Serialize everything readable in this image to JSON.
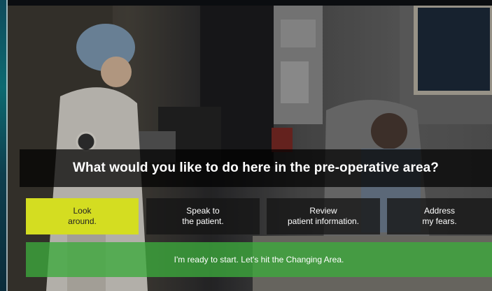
{
  "question": "What would you like to do here in the pre-operative area?",
  "options": [
    {
      "label": "Look\naround.",
      "selected": true
    },
    {
      "label": "Speak to\nthe patient.",
      "selected": false
    },
    {
      "label": "Review\npatient information.",
      "selected": false
    },
    {
      "label": "Address\nmy fears.",
      "selected": false
    }
  ],
  "start_button": "I'm ready to start. Let's hit the Changing Area.",
  "colors": {
    "selected_option": "#d4dd21",
    "start_bar": "#3caa3c"
  }
}
